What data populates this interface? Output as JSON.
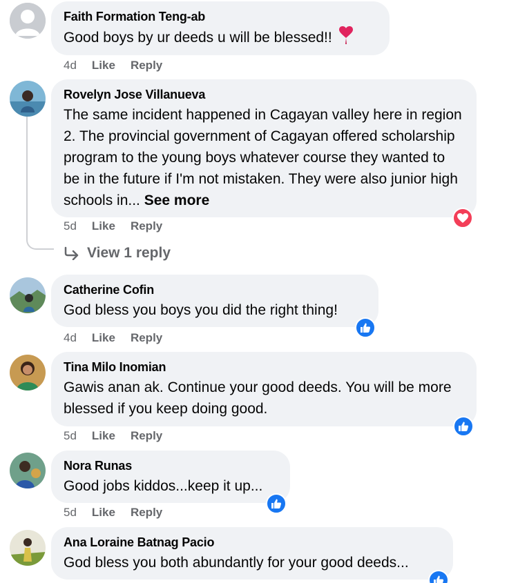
{
  "comments": [
    {
      "author": "Faith Formation Teng-ab",
      "text": "Good boys by ur deeds u will be blessed!! ",
      "age": "4d",
      "like": "Like",
      "reply": "Reply",
      "avatar_icon": "default-person-avatar"
    },
    {
      "author": "Rovelyn Jose Villanueva",
      "text": "The same incident happened in Cagayan valley here in region 2. The provincial government of Cagayan offered scholarship program to the young boys whatever course they wanted to be in the future if I'm not mistaken. They were also junior high schools in... ",
      "see_more": "See more",
      "age": "5d",
      "like": "Like",
      "reply": "Reply",
      "reaction": "love",
      "view_replies": "View 1 reply"
    },
    {
      "author": "Catherine Cofin",
      "text": "God bless you boys you did the right thing!",
      "age": "4d",
      "like": "Like",
      "reply": "Reply",
      "reaction": "like"
    },
    {
      "author": "Tina Milo Inomian",
      "text": "Gawis anan ak. Continue your good deeds. You will be more blessed if you keep doing good.",
      "age": "5d",
      "like": "Like",
      "reply": "Reply",
      "reaction": "like"
    },
    {
      "author": "Nora Runas",
      "text": "Good jobs kiddos...keep it up...",
      "age": "5d",
      "like": "Like",
      "reply": "Reply",
      "reaction": "like"
    },
    {
      "author": "Ana Loraine Batnag Pacio",
      "text": "God bless you both abundantly for your good deeds...",
      "reaction": "like"
    }
  ],
  "colors": {
    "bubble": "#f0f2f5",
    "meta": "#65676b",
    "like_blue": "#1877f2",
    "love_red": "#f33e58"
  }
}
